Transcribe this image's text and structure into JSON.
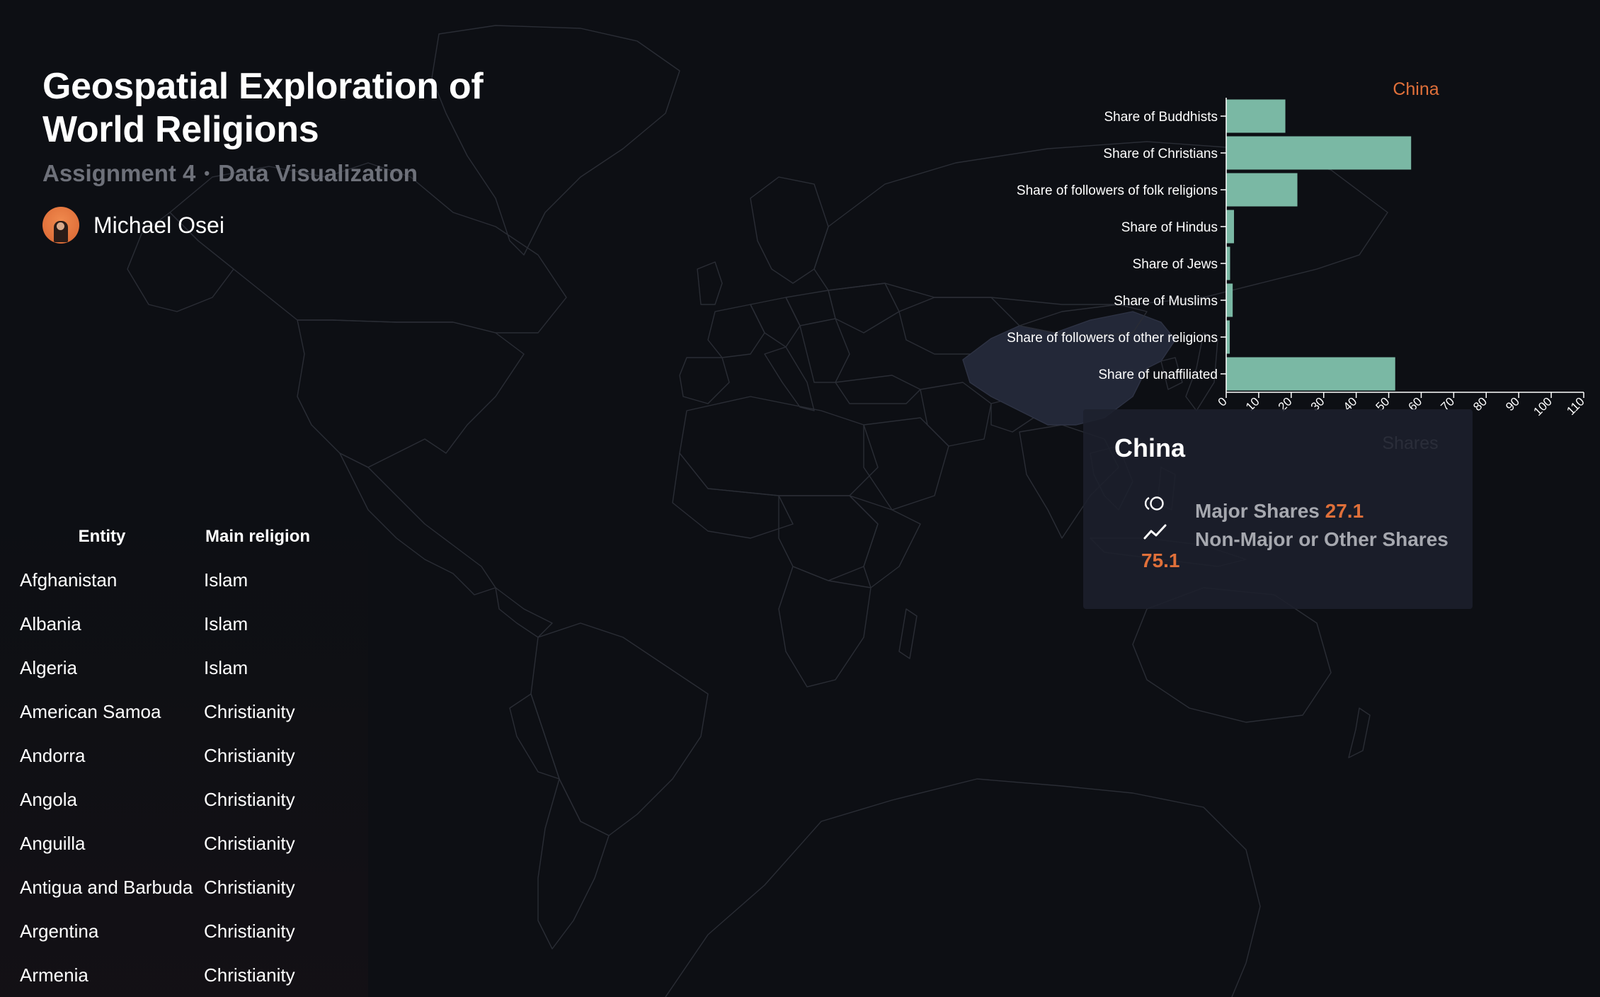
{
  "header": {
    "title_line1": "Geospatial Exploration of",
    "title_line2": "World Religions",
    "subtitle_left": "Assignment 4",
    "subtitle_sep": "•",
    "subtitle_right": "Data Visualization",
    "author": "Michael Osei"
  },
  "map": {
    "highlighted_country": "China",
    "highlight_color": "#232838",
    "land_stroke": "#2c2f37"
  },
  "table": {
    "headers": [
      "Entity",
      "Main religion"
    ],
    "rows": [
      [
        "Afghanistan",
        "Islam"
      ],
      [
        "Albania",
        "Islam"
      ],
      [
        "Algeria",
        "Islam"
      ],
      [
        "American Samoa",
        "Christianity"
      ],
      [
        "Andorra",
        "Christianity"
      ],
      [
        "Angola",
        "Christianity"
      ],
      [
        "Anguilla",
        "Christianity"
      ],
      [
        "Antigua and Barbuda",
        "Christianity"
      ],
      [
        "Argentina",
        "Christianity"
      ],
      [
        "Armenia",
        "Christianity"
      ]
    ]
  },
  "chart_data": {
    "type": "bar",
    "orientation": "horizontal",
    "title": "China",
    "xlabel": "Shares",
    "ylabel": "",
    "xlim": [
      0,
      110
    ],
    "x_ticks": [
      0,
      10,
      20,
      30,
      40,
      50,
      60,
      70,
      80,
      90,
      100,
      110
    ],
    "categories": [
      "Share of Buddhists",
      "Share of Christians",
      "Share of followers of folk religions",
      "Share of Hindus",
      "Share of Jews",
      "Share of Muslims",
      "Share of followers of other religions",
      "Share of unaffiliated"
    ],
    "values": [
      18.2,
      56.9,
      21.9,
      2.4,
      1.2,
      2.0,
      1.1,
      52.0
    ],
    "bar_color": "#7ab8a4",
    "title_color": "#e0703a",
    "grid": false
  },
  "tooltip": {
    "country": "China",
    "major_label": "Major Shares",
    "major_value": "27.1",
    "other_label": "Non-Major or Other Shares",
    "other_value": "75.1",
    "major_icon": "rings-icon",
    "other_icon": "trend-line-icon",
    "accent": "#e0703a"
  }
}
